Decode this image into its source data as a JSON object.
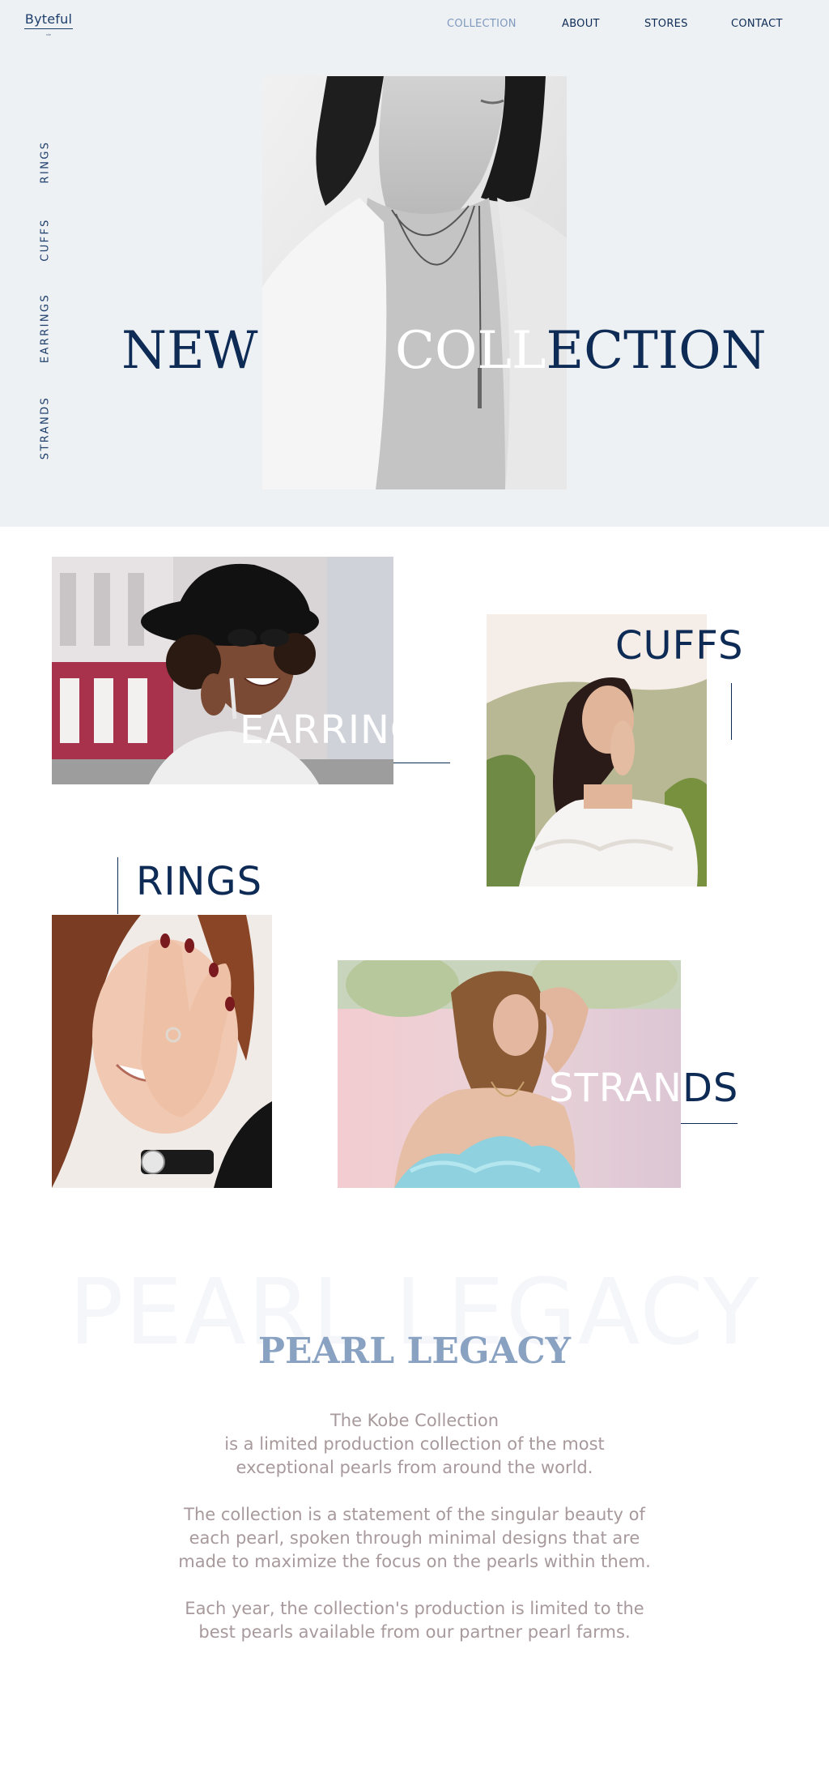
{
  "brand": {
    "name": "Byteful",
    "tagline": "site"
  },
  "nav": {
    "items": [
      {
        "label": "COLLECTION",
        "active": true
      },
      {
        "label": "ABOUT",
        "active": false
      },
      {
        "label": "STORES",
        "active": false
      },
      {
        "label": "CONTACT",
        "active": false
      }
    ]
  },
  "side_nav": [
    "RINGS",
    "CUFFS",
    "EARRINGS",
    "STRANDS"
  ],
  "hero": {
    "word_left": "NEW",
    "word_right": "COLLECTION",
    "image": "woman-black-white-necklace-photo"
  },
  "categories": {
    "earrings": {
      "label": "EARRINGS",
      "image": "woman-hat-sunglasses-earrings-photo"
    },
    "cuffs": {
      "label": "CUFFS",
      "image": "woman-white-blouse-hillside-photo"
    },
    "rings": {
      "label": "RINGS",
      "image": "woman-hand-ring-photo"
    },
    "strands": {
      "label": "STRANDS",
      "image": "woman-blue-dress-necklace-photo"
    }
  },
  "legacy": {
    "watermark": "PEARL LEGACY",
    "title": "PEARL LEGACY",
    "p1": [
      "The Kobe Collection",
      "is a limited production collection of the most",
      "exceptional pearls from around the world."
    ],
    "p2": [
      "The collection is a statement of the singular beauty of",
      "each pearl, spoken through minimal designs that are",
      "made to maximize the focus on the pearls within them."
    ],
    "p3": [
      "Each year, the collection's production is limited to the",
      "best pearls available from our partner pearl farms."
    ]
  },
  "colors": {
    "navy": "#0d2b55",
    "accent": "#7f99bd",
    "hero_bg": "#eef1f4",
    "title_blue": "#8aa2c2",
    "body_text": "#a7999c"
  }
}
